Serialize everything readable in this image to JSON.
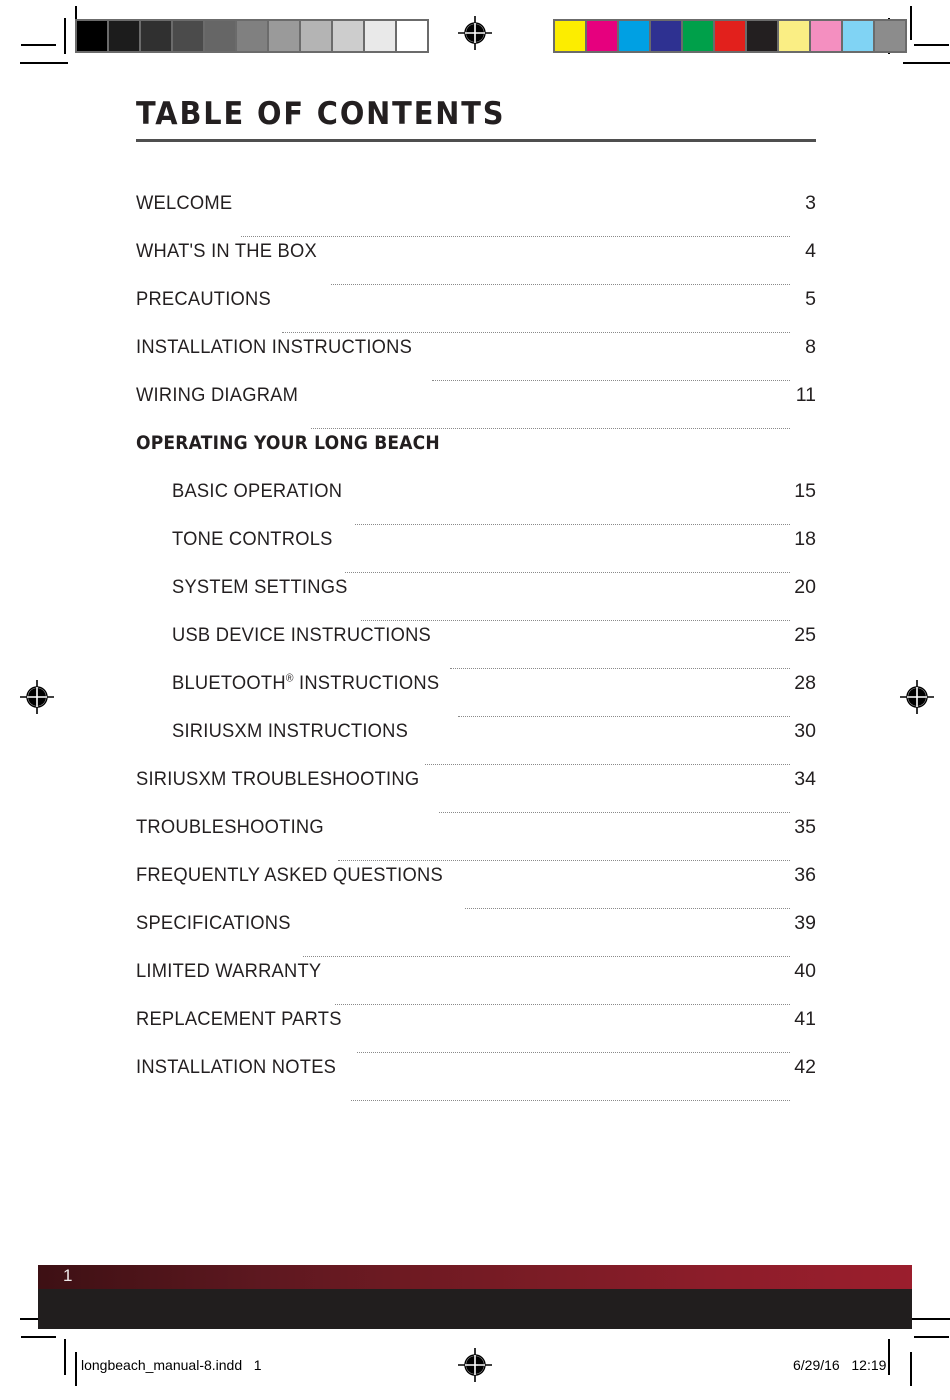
{
  "document": {
    "title": "TABLE OF CONTENTS",
    "page_number": "1"
  },
  "colors": {
    "text": "#231f20",
    "rule": "#4f4f4f",
    "leader": "#8a8a8a",
    "footer_red_start": "#3d1014",
    "footer_red_end": "#9b1e2d",
    "footer_dark": "#211e1e",
    "page_number_text": "#efe9e9",
    "calib_frame": "#6b6b6b"
  },
  "calibration": {
    "grayscale_swatches": [
      "#000000",
      "#1c1c1c",
      "#303030",
      "#4b4b4b",
      "#666666",
      "#808080",
      "#9a9a9a",
      "#b4b4b4",
      "#cdcdcd",
      "#e9e9e9",
      "#ffffff"
    ],
    "color_swatches": [
      "#fced00",
      "#e6007e",
      "#00a0e3",
      "#2e3191",
      "#00a04a",
      "#e2201c",
      "#231f20",
      "#faee84",
      "#f48fc0",
      "#80d3f4",
      "#8c8c8c"
    ]
  },
  "toc": {
    "entries": [
      {
        "label": "WELCOME",
        "page": "3",
        "level": "main"
      },
      {
        "label": "WHAT'S IN THE BOX",
        "page": "4",
        "level": "main"
      },
      {
        "label": "PRECAUTIONS",
        "page": "5",
        "level": "main"
      },
      {
        "label": "INSTALLATION INSTRUCTIONS",
        "page": "8",
        "level": "main"
      },
      {
        "label": "WIRING DIAGRAM",
        "page": "11",
        "level": "main"
      },
      {
        "label": "OPERATING YOUR LONG BEACH",
        "page": "",
        "level": "section"
      },
      {
        "label": "BASIC OPERATION",
        "page": "15",
        "level": "sub"
      },
      {
        "label": "TONE CONTROLS",
        "page": "18",
        "level": "sub"
      },
      {
        "label": "SYSTEM SETTINGS",
        "page": "20",
        "level": "sub"
      },
      {
        "label": "USB DEVICE INSTRUCTIONS",
        "page": "25",
        "level": "sub"
      },
      {
        "label": "BLUETOOTH® INSTRUCTIONS",
        "page": "28",
        "level": "sub",
        "trademark": true
      },
      {
        "label": "SIRIUSXM INSTRUCTIONS",
        "page": "30",
        "level": "sub"
      },
      {
        "label": "SIRIUSXM TROUBLESHOOTING",
        "page": "34",
        "level": "main"
      },
      {
        "label": "TROUBLESHOOTING",
        "page": "35",
        "level": "main"
      },
      {
        "label": "FREQUENTLY ASKED QUESTIONS",
        "page": "36",
        "level": "main"
      },
      {
        "label": "SPECIFICATIONS",
        "page": "39",
        "level": "main"
      },
      {
        "label": "LIMITED WARRANTY",
        "page": "40",
        "level": "main"
      },
      {
        "label": "REPLACEMENT PARTS",
        "page": "41",
        "level": "main"
      },
      {
        "label": "INSTALLATION NOTES",
        "page": "42",
        "level": "main"
      }
    ]
  },
  "print_slug": {
    "file_name": "longbeach_manual-8.indd   1",
    "date_time": "6/29/16   12:19"
  }
}
